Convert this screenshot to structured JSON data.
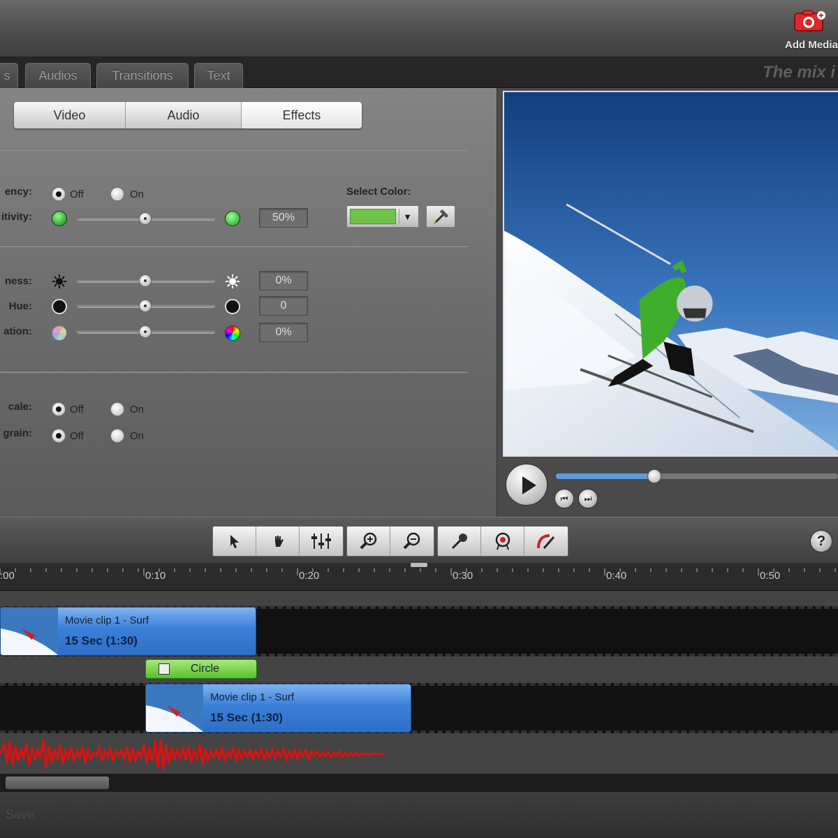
{
  "header": {
    "add_media_label": "Add Media"
  },
  "tabs": [
    {
      "label": "s"
    },
    {
      "label": "Audios"
    },
    {
      "label": "Transitions"
    },
    {
      "label": "Text"
    }
  ],
  "tagline": "The mix i",
  "properties": {
    "segments": [
      {
        "label": "Video",
        "active": false
      },
      {
        "label": "Audio",
        "active": false
      },
      {
        "label": "Effects",
        "active": true
      }
    ],
    "transparency": {
      "label": "ency:",
      "off_label": "Off",
      "on_label": "On",
      "selected": "Off"
    },
    "sensitivity": {
      "label": "itivity:",
      "value": "50%",
      "level": 0.5
    },
    "select_color": {
      "label": "Select Color:",
      "color": "#6fc34a"
    },
    "brightness": {
      "label": "ness:",
      "value": "0%",
      "level": 0.5
    },
    "hue": {
      "label": "Hue:",
      "value": "0",
      "level": 0.5
    },
    "saturation": {
      "label": "ation:",
      "value": "0%",
      "level": 0.5
    },
    "grayscale": {
      "label": "cale:",
      "off_label": "Off",
      "on_label": "On",
      "selected": "Off"
    },
    "film_grain": {
      "label": "grain:",
      "off_label": "Off",
      "on_label": "On",
      "selected": "Off"
    }
  },
  "player": {
    "progress": 0.35
  },
  "toolbar": {
    "icons": [
      "select-arrow-icon",
      "hand-icon",
      "mixer-icon",
      "zoom-in-icon",
      "zoom-out-icon",
      "microphone-icon",
      "record-icon",
      "tools-icon",
      "help-icon"
    ],
    "help_label": "?"
  },
  "ruler": {
    "ticks": [
      ":00",
      "0:10",
      "0:20",
      "0:30",
      "0:40",
      "0:50"
    ]
  },
  "timeline": {
    "clip1": {
      "title": "Movie clip 1 - Surf",
      "duration": "15 Sec (1:30)"
    },
    "effect": {
      "label": "Circle"
    },
    "clip2": {
      "title": "Movie clip 1 - Surf",
      "duration": "15 Sec (1:30)"
    }
  },
  "footer": {
    "ghost_label": "Save"
  },
  "colors": {
    "accent_blue": "#3a7fd8",
    "effect_green": "#58c02a",
    "waveform_red": "#e01010"
  }
}
